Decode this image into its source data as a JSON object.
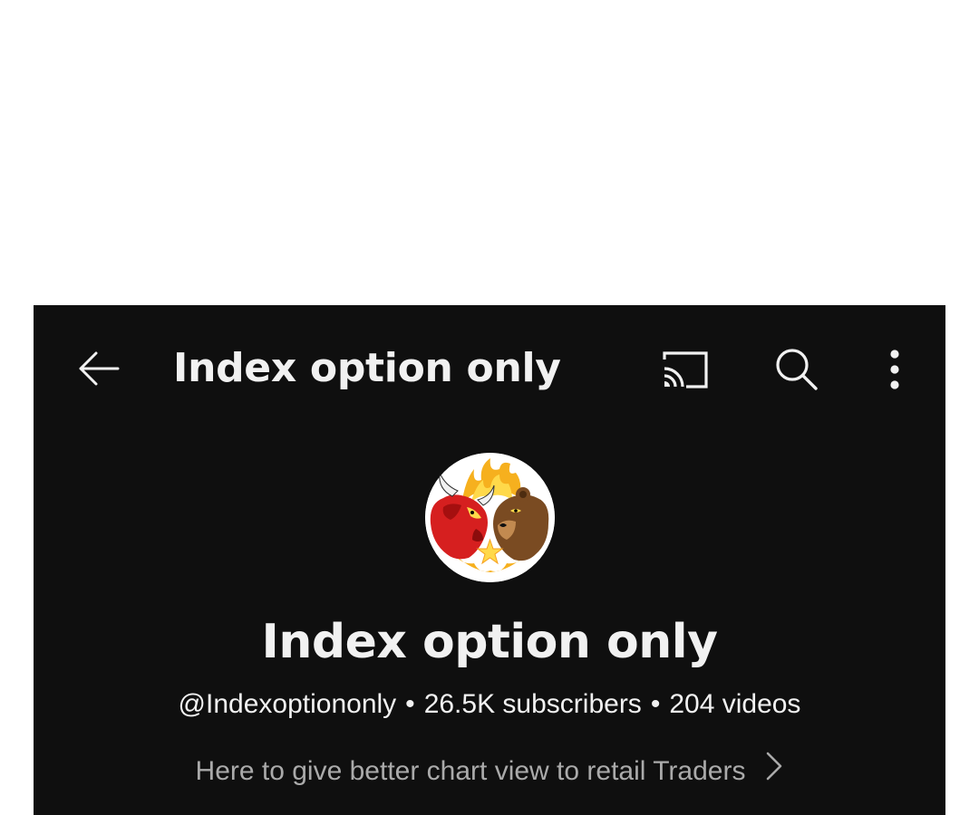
{
  "header": {
    "title": "Index option only",
    "icons": {
      "back": "back-arrow-icon",
      "cast": "cast-icon",
      "search": "search-icon",
      "more": "more-vert-icon"
    }
  },
  "channel": {
    "name": "Index option only",
    "handle": "@Indexoptiononly",
    "separator": "•",
    "subscribers": "26.5K subscribers",
    "videos": "204 videos",
    "description": "Here to give better chart view to retail Traders",
    "avatar": "bull-and-bear-logo"
  },
  "colors": {
    "background": "#0f0f0f",
    "text_primary": "#f1f1f1",
    "text_secondary": "#aaaaaa",
    "page_background": "#ffffff"
  }
}
